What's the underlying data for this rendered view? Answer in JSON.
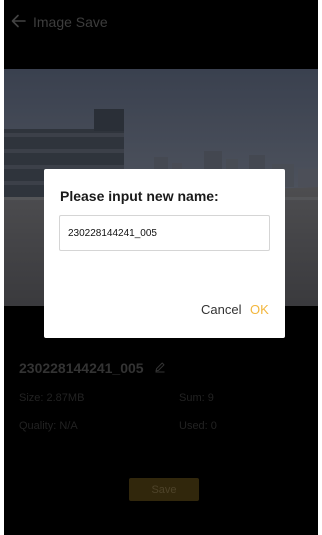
{
  "header": {
    "title": "Image Save",
    "back_icon": "arrow-left-icon"
  },
  "file": {
    "name": "230228144241_005",
    "edit_icon": "pencil-icon",
    "size": "Size: 2.87MB",
    "sum": "Sum: 9",
    "quality": "Quality: N/A",
    "used": "Used: 0"
  },
  "actions": {
    "save_label": "Save"
  },
  "dialog": {
    "title": "Please input new name:",
    "input_value": "230228144241_005",
    "cancel_label": "Cancel",
    "ok_label": "OK"
  },
  "colors": {
    "background": "#000000",
    "accent": "#f3b73e",
    "save_button": "#5a4716"
  }
}
